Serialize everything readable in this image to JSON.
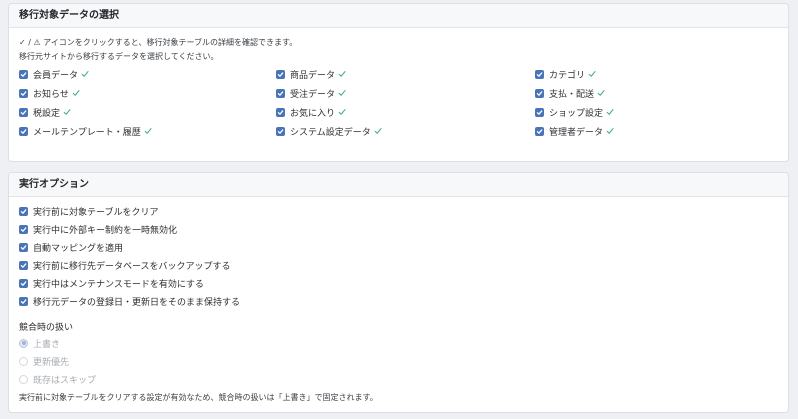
{
  "select_panel": {
    "title": "移行対象データの選択",
    "note_icon_line": "✓ / ⚠ アイコンをクリックすると、移行対象テーブルの詳細を確認できます。",
    "note_select_line": "移行元サイトから移行するデータを選択してください。",
    "items": [
      {
        "label": "会員データ",
        "checked": true,
        "status": "ok"
      },
      {
        "label": "商品データ",
        "checked": true,
        "status": "ok"
      },
      {
        "label": "カテゴリ",
        "checked": true,
        "status": "ok"
      },
      {
        "label": "お知らせ",
        "checked": true,
        "status": "ok"
      },
      {
        "label": "受注データ",
        "checked": true,
        "status": "ok"
      },
      {
        "label": "支払・配送",
        "checked": true,
        "status": "ok"
      },
      {
        "label": "税設定",
        "checked": true,
        "status": "ok"
      },
      {
        "label": "お気に入り",
        "checked": true,
        "status": "ok"
      },
      {
        "label": "ショップ設定",
        "checked": true,
        "status": "ok"
      },
      {
        "label": "メールテンプレート・履歴",
        "checked": true,
        "status": "ok"
      },
      {
        "label": "システム設定データ",
        "checked": true,
        "status": "ok"
      },
      {
        "label": "管理者データ",
        "checked": true,
        "status": "ok"
      }
    ]
  },
  "options_panel": {
    "title": "実行オプション",
    "options": [
      {
        "label": "実行前に対象テーブルをクリア",
        "checked": true
      },
      {
        "label": "実行中に外部キー制約を一時無効化",
        "checked": true
      },
      {
        "label": "自動マッピングを適用",
        "checked": true
      },
      {
        "label": "実行前に移行先データベースをバックアップする",
        "checked": true
      },
      {
        "label": "実行中はメンテナンスモードを有効にする",
        "checked": true
      },
      {
        "label": "移行元データの登録日・更新日をそのまま保持する",
        "checked": true
      }
    ],
    "conflict": {
      "label": "競合時の扱い",
      "choices": [
        {
          "label": "上書き",
          "selected": true,
          "disabled": true
        },
        {
          "label": "更新優先",
          "selected": false,
          "disabled": true
        },
        {
          "label": "既存はスキップ",
          "selected": false,
          "disabled": true
        }
      ],
      "note": "実行前に対象テーブルをクリアする設定が有効なため、競合時の扱いは「上書き」で固定されます。"
    }
  },
  "colors": {
    "checkbox": "#4a74b8",
    "ok_check": "#3fae7a",
    "page_bg": "#eef0f3"
  }
}
